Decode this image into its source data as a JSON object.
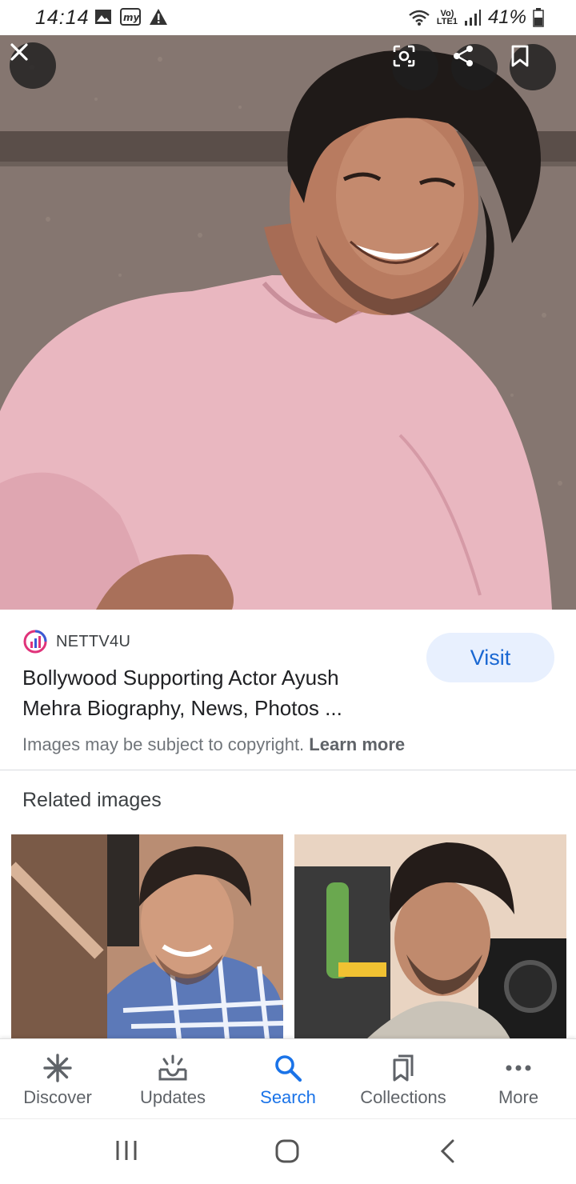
{
  "status": {
    "time": "14:14",
    "net_top": "Vo)",
    "net_bottom": "LTE1",
    "battery": "41%"
  },
  "hero_actions": {
    "close": "close-icon",
    "lens": "lens-icon",
    "share": "share-icon",
    "bookmark": "bookmark-icon"
  },
  "result": {
    "source": "NETTV4U",
    "title": "Bollywood Supporting Actor Ayush Mehra Biography, News, Photos ...",
    "visit_label": "Visit",
    "copyright_text": "Images may be subject to copyright.",
    "learn_more": "Learn more"
  },
  "related": {
    "heading": "Related images"
  },
  "bottom_nav": {
    "items": [
      {
        "label": "Discover",
        "icon": "asterisk-icon"
      },
      {
        "label": "Updates",
        "icon": "updates-icon"
      },
      {
        "label": "Search",
        "icon": "search-icon"
      },
      {
        "label": "Collections",
        "icon": "collections-icon"
      },
      {
        "label": "More",
        "icon": "more-dots-icon"
      }
    ],
    "active": "Search"
  },
  "colors": {
    "accent": "#1a73e8",
    "visit_bg": "#e8f0fe"
  }
}
